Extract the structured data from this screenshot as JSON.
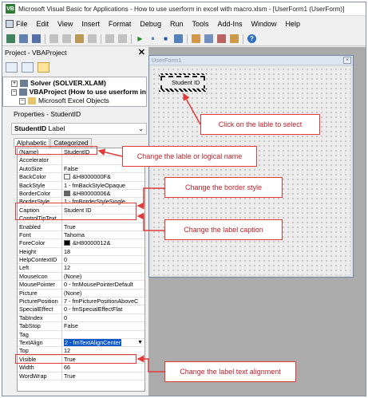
{
  "window": {
    "title": "Microsoft Visual Basic for Applications - How to use userform in excel with macro.xlsm - [UserForm1 (UserForm)]",
    "app_icon": "VB"
  },
  "menu": {
    "items": [
      "File",
      "Edit",
      "View",
      "Insert",
      "Format",
      "Debug",
      "Run",
      "Tools",
      "Add-Ins",
      "Window",
      "Help"
    ]
  },
  "toolbar": {
    "icons": [
      "excel-icon",
      "insert-icon",
      "save-icon",
      "cut-icon",
      "copy-icon",
      "paste-icon",
      "find-icon",
      "undo-icon",
      "redo-icon",
      "run-icon",
      "break-icon",
      "reset-icon",
      "design-mode-icon",
      "project-explorer-icon",
      "properties-icon",
      "object-browser-icon",
      "toolbox-icon",
      "help-icon"
    ],
    "glyphs": {
      "run": "▶",
      "break": "⏸",
      "reset": "■",
      "help": "?"
    }
  },
  "project_panel": {
    "title": "Project - VBAProject",
    "close_glyph": "✕",
    "tree": [
      {
        "expander": "+",
        "label": "Solver (SOLVER.XLAM)"
      },
      {
        "expander": "−",
        "label": "VBAProject (How to use userform in"
      },
      {
        "expander": "−",
        "label": "Microsoft Excel Objects"
      }
    ]
  },
  "properties_panel": {
    "title": "Properties - StudentID",
    "object_name": "StudentID",
    "object_type": "Label",
    "tabs": [
      "Alphabetic",
      "Categorized"
    ],
    "rows": [
      {
        "name": "(Name)",
        "value": "StudentID"
      },
      {
        "name": "Accelerator",
        "value": ""
      },
      {
        "name": "AutoSize",
        "value": "False"
      },
      {
        "name": "BackColor",
        "value": "&H8000000F&",
        "swatch": "#f0f0f0"
      },
      {
        "name": "BackStyle",
        "value": "1 - fmBackStyleOpaque"
      },
      {
        "name": "BorderColor",
        "value": "&H80000006&",
        "swatch": "#646464"
      },
      {
        "name": "BorderStyle",
        "value": "1 - fmBorderStyleSingle"
      },
      {
        "name": "Caption",
        "value": "Student ID"
      },
      {
        "name": "ControlTipText",
        "value": ""
      },
      {
        "name": "Enabled",
        "value": "True"
      },
      {
        "name": "Font",
        "value": "Tahoma"
      },
      {
        "name": "ForeColor",
        "value": "&H80000012&",
        "swatch": "#000000"
      },
      {
        "name": "Height",
        "value": "18"
      },
      {
        "name": "HelpContextID",
        "value": "0"
      },
      {
        "name": "Left",
        "value": "12"
      },
      {
        "name": "MouseIcon",
        "value": "(None)"
      },
      {
        "name": "MousePointer",
        "value": "0 - fmMousePointerDefault"
      },
      {
        "name": "Picture",
        "value": "(None)"
      },
      {
        "name": "PicturePosition",
        "value": "7 - fmPicturePositionAboveC"
      },
      {
        "name": "SpecialEffect",
        "value": "0 - fmSpecialEffectFlat"
      },
      {
        "name": "TabIndex",
        "value": "0"
      },
      {
        "name": "TabStop",
        "value": "False"
      },
      {
        "name": "Tag",
        "value": ""
      },
      {
        "name": "TextAlign",
        "value": "2 - fmTextAlignCenter",
        "selected": true
      },
      {
        "name": "Top",
        "value": "12"
      },
      {
        "name": "Visible",
        "value": "True"
      },
      {
        "name": "Width",
        "value": "66"
      },
      {
        "name": "WordWrap",
        "value": "True"
      }
    ]
  },
  "userform": {
    "title": "UserForm1",
    "close_glyph": "×",
    "label_caption": "Student ID"
  },
  "annotations": {
    "click_select": "Click on the lable to select",
    "change_name": "Change the lable or logical name",
    "change_border": "Change the border style",
    "change_caption": "Change the label caption",
    "change_align": "Change the label text alignment",
    "color": "#e23a3a"
  }
}
